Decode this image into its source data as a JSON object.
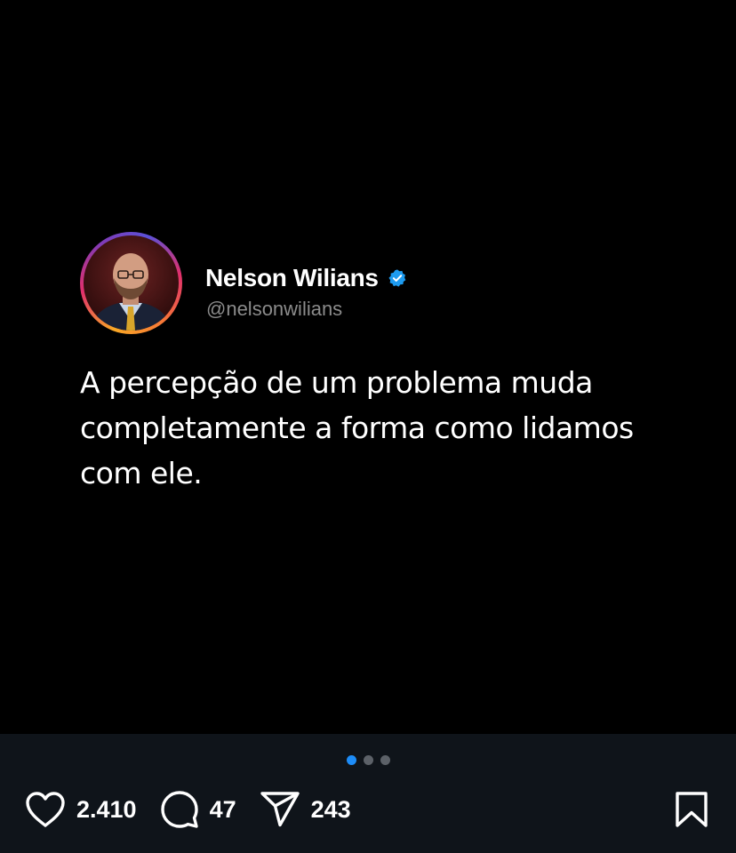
{
  "post": {
    "author_name": "Nelson Wilians",
    "author_handle": "@nelsonwilians",
    "text": "A percepção de um problema muda completamente a forma como lidamos com ele.",
    "verified_icon": "verified-badge-icon",
    "verified_color": "#1d9bf0"
  },
  "carousel": {
    "total_slides": 3,
    "current_slide": 1,
    "active_color": "#1d8cf7"
  },
  "actions": {
    "likes": "2.410",
    "comments": "47",
    "shares": "243",
    "like_icon": "heart-icon",
    "comment_icon": "comment-bubble-icon",
    "share_icon": "paper-plane-icon",
    "save_icon": "bookmark-icon"
  }
}
